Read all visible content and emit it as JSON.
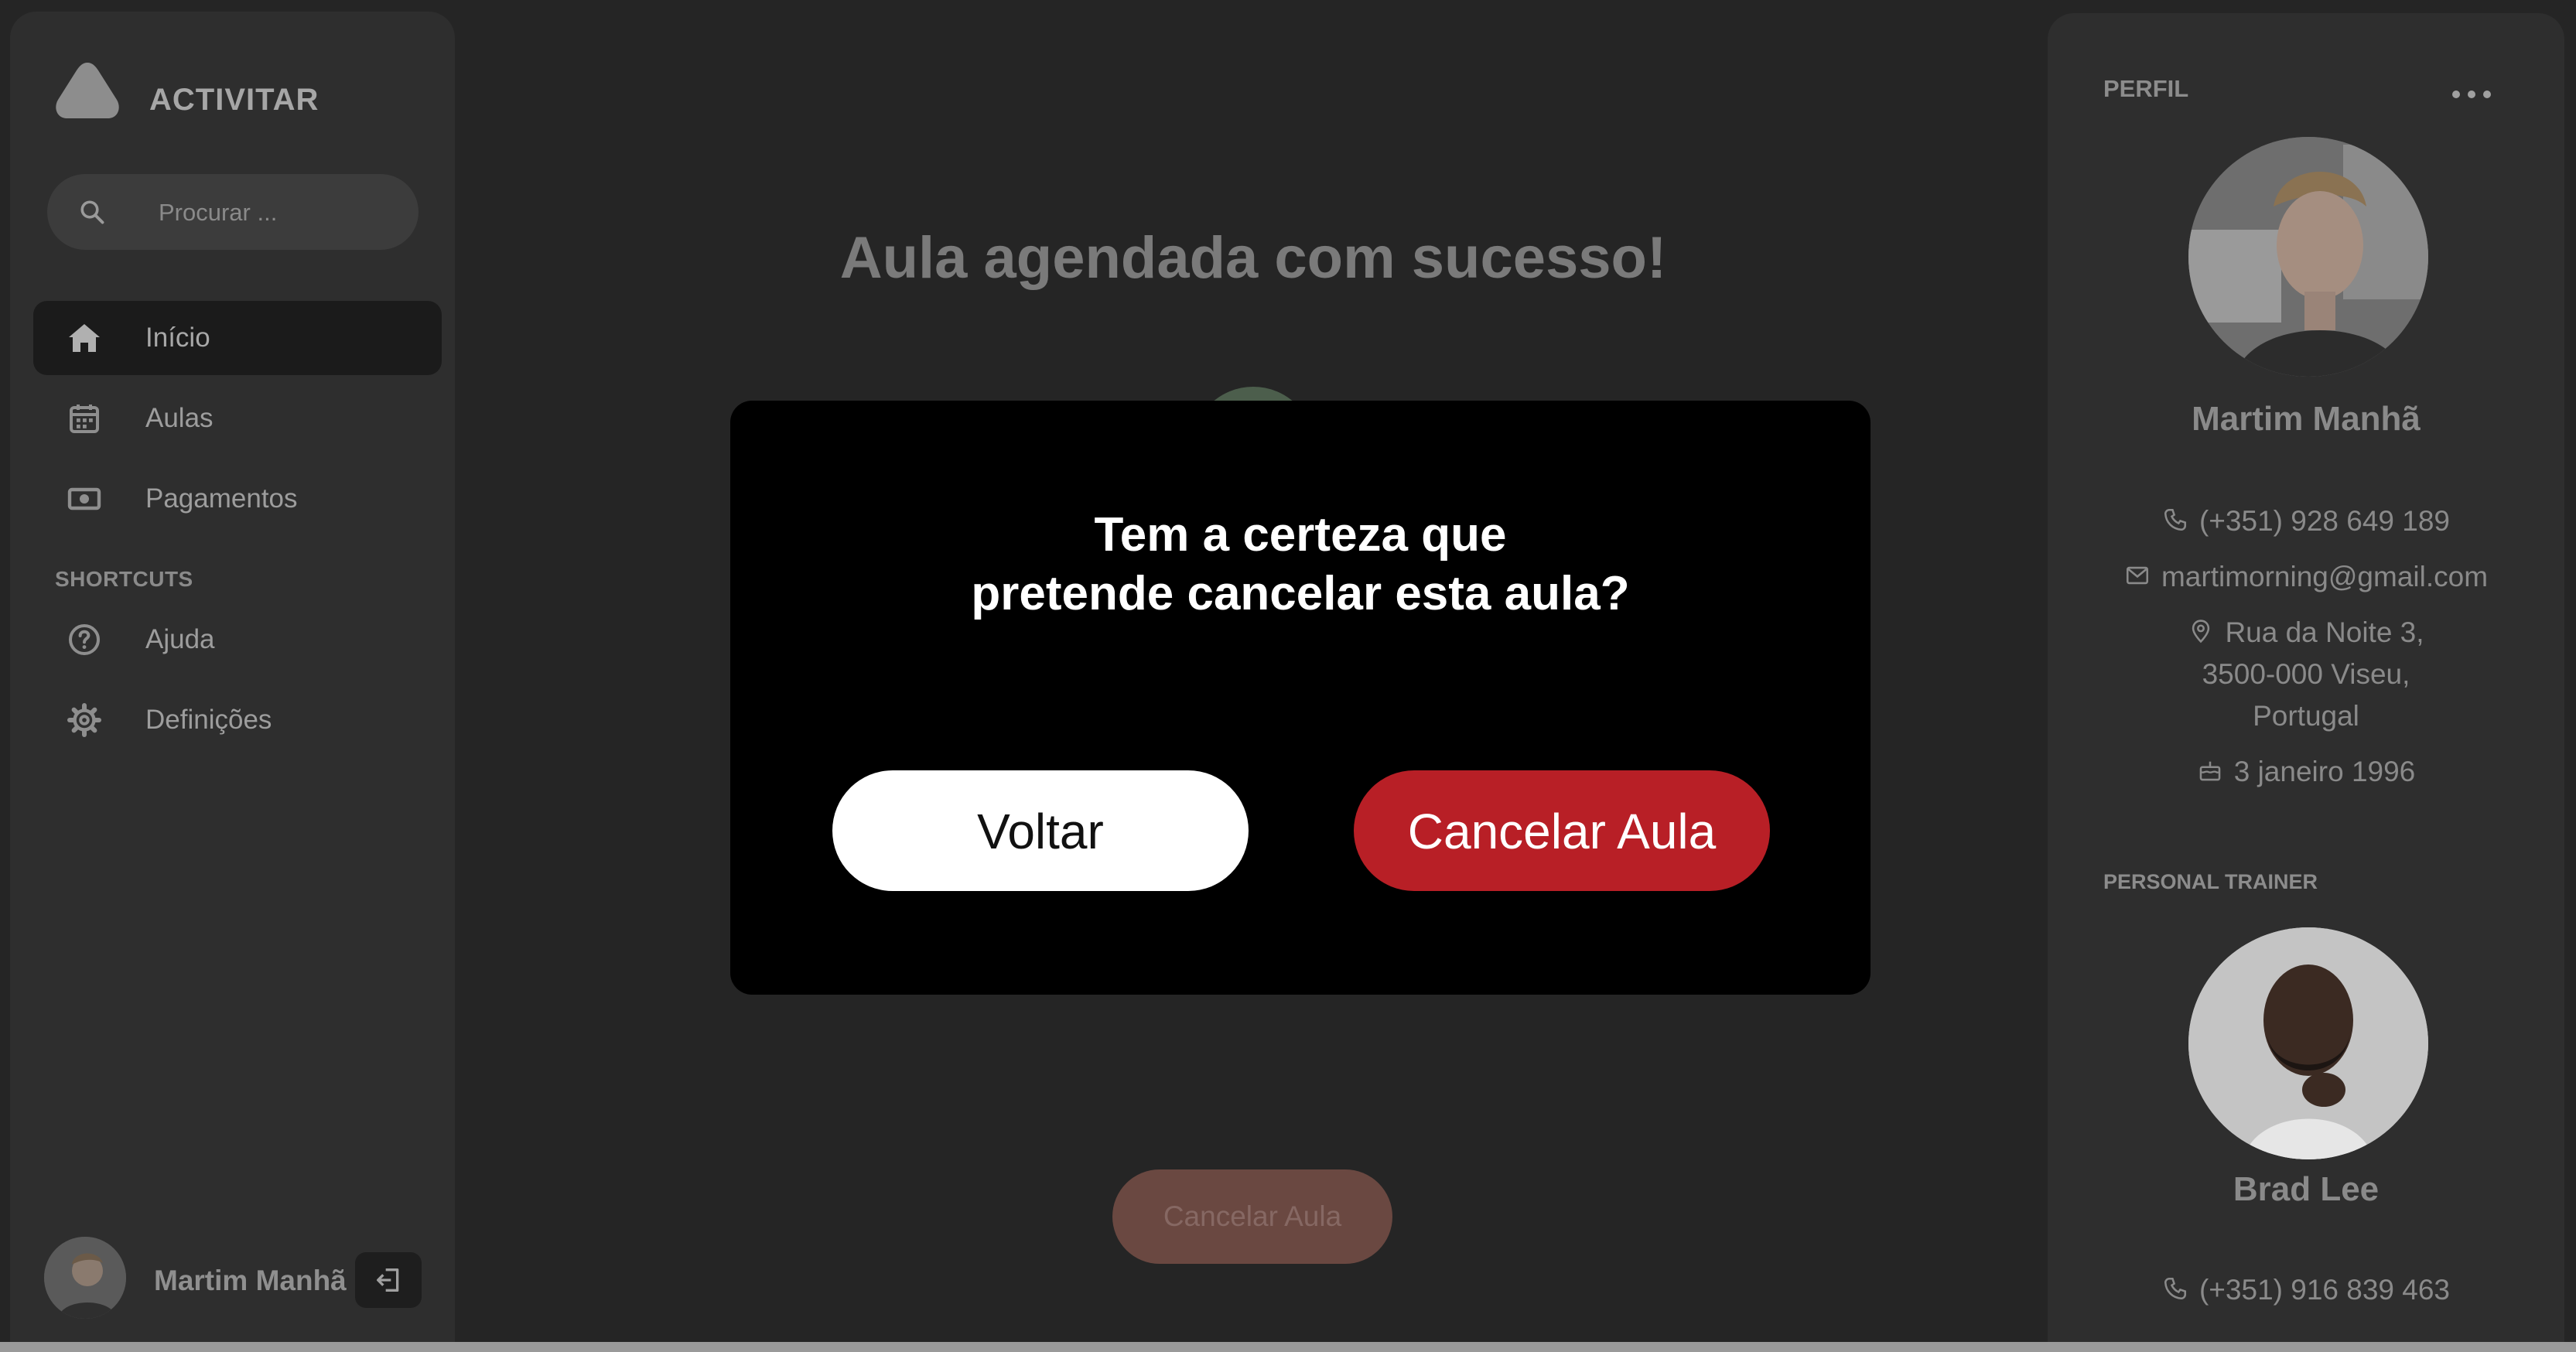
{
  "app": {
    "name": "ACTIVITAR"
  },
  "sidebar": {
    "search_placeholder": "Procurar ...",
    "nav": [
      {
        "label": "Início",
        "icon": "home-icon",
        "active": true
      },
      {
        "label": "Aulas",
        "icon": "calendar-icon",
        "active": false
      },
      {
        "label": "Pagamentos",
        "icon": "money-icon",
        "active": false
      }
    ],
    "shortcuts_label": "SHORTCUTS",
    "shortcuts": [
      {
        "label": "Ajuda",
        "icon": "help-icon"
      },
      {
        "label": "Definições",
        "icon": "gear-icon"
      }
    ],
    "user_name": "Martim Manhã"
  },
  "main": {
    "title": "Aula agendada com sucesso!",
    "cancel_label": "Cancelar Aula"
  },
  "profile": {
    "section_label": "PERFIL",
    "name": "Martim Manhã",
    "phone": "(+351) 928 649 189",
    "email": "martimorning@gmail.com",
    "address_line1": "Rua da Noite 3,",
    "address_line2": "3500-000 Viseu,",
    "address_line3": "Portugal",
    "birthdate": "3 janeiro 1996"
  },
  "trainer": {
    "section_label": "PERSONAL TRAINER",
    "name": "Brad Lee",
    "phone": "(+351) 916 839 463"
  },
  "modal": {
    "line1": "Tem a certeza que",
    "line2": "pretende cancelar esta aula?",
    "back_label": "Voltar",
    "confirm_label": "Cancelar Aula"
  },
  "colors": {
    "confirm_button": "#b81f26",
    "modal_background": "#000000",
    "overlay_page": "#252525"
  }
}
